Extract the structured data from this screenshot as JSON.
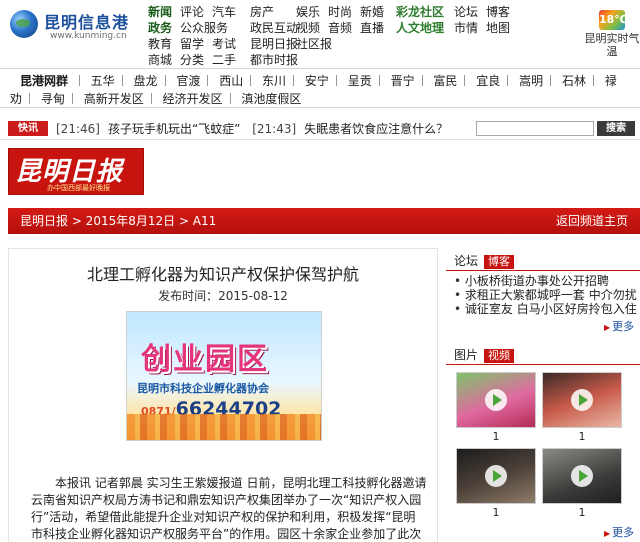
{
  "logo": {
    "name": "昆明信息港",
    "url": "www.kunming.cn"
  },
  "topnav": {
    "columns": [
      [
        "新闻",
        "政务",
        "教育",
        "商城"
      ],
      [
        "评论",
        "公众服务",
        "留学",
        "分类"
      ],
      [
        "汽车",
        "",
        "考试",
        "二手"
      ],
      [
        "房产",
        "政民互动",
        "昆明日报",
        "都市时报"
      ],
      [
        "娱乐",
        "视频",
        "社区报",
        ""
      ],
      [
        "时尚",
        "音频",
        "",
        ""
      ],
      [
        "新婚",
        "直播",
        "",
        ""
      ],
      [
        "彩龙社区",
        "人文地理",
        "",
        ""
      ],
      [
        "论坛",
        "市情",
        "",
        ""
      ],
      [
        "博客",
        "地图",
        "",
        ""
      ]
    ]
  },
  "weather": {
    "badge": "18℃",
    "label": "昆明实时气温"
  },
  "areas": {
    "brand": "昆港网群",
    "line1": [
      "五华",
      "盘龙",
      "官渡",
      "西山",
      "东川",
      "安宁",
      "呈贡",
      "晋宁",
      "富民",
      "宜良",
      "嵩明",
      "石林",
      "禄"
    ],
    "line2": [
      "劝",
      "寻甸",
      "高新开发区",
      "经济开发区",
      "滇池度假区"
    ]
  },
  "ticker": {
    "tag": "快讯",
    "items": [
      {
        "time": "[21:46]",
        "text": "孩子玩手机玩出“飞蚊症”"
      },
      {
        "time": "[21:43]",
        "text": "失眠患者饮食应注意什么？"
      }
    ],
    "search_placeholder": "",
    "search_button": "搜索"
  },
  "masthead": {
    "title": "昆明日报",
    "sub": "办中国西部最好晚报"
  },
  "breadcrumb": {
    "path": "昆明日报 > 2015年8月12日 > A11",
    "back": "返回频道主页"
  },
  "article": {
    "headline": "北理工孵化器为知识产权保护保驾护航",
    "date": "发布时间：2015-08-12",
    "poster": {
      "title": "创业园区",
      "org": "昆明市科技企业孵化器协会",
      "phone_area": "0871/",
      "phone": "66244702"
    },
    "body": "本报讯 记者郭晨 实习生王紫媛报道 日前，昆明北理工科技孵化器邀请云南省知识产权局方涛书记和鼎宏知识产权集团举办了一次“知识产权入园行”活动，希望借此能提升企业对知识产权的保护和利用，积极发挥“昆明市科技企业孵化器知识产权服务平台”的作用。园区十余家企业参加了此次活动。"
  },
  "sidebar": {
    "forum": {
      "label": "论坛",
      "tab": "博客",
      "items": [
        "小板桥街道办事处公开招聘",
        "求租正大紫都城呼一套 中介勿扰",
        "诚征室友 白马小区好房拎包入住"
      ],
      "more": "更多"
    },
    "video": {
      "label": "图片",
      "tab": "视频",
      "captions": [
        "1",
        "1",
        "1",
        "1"
      ],
      "more": "更多"
    }
  }
}
